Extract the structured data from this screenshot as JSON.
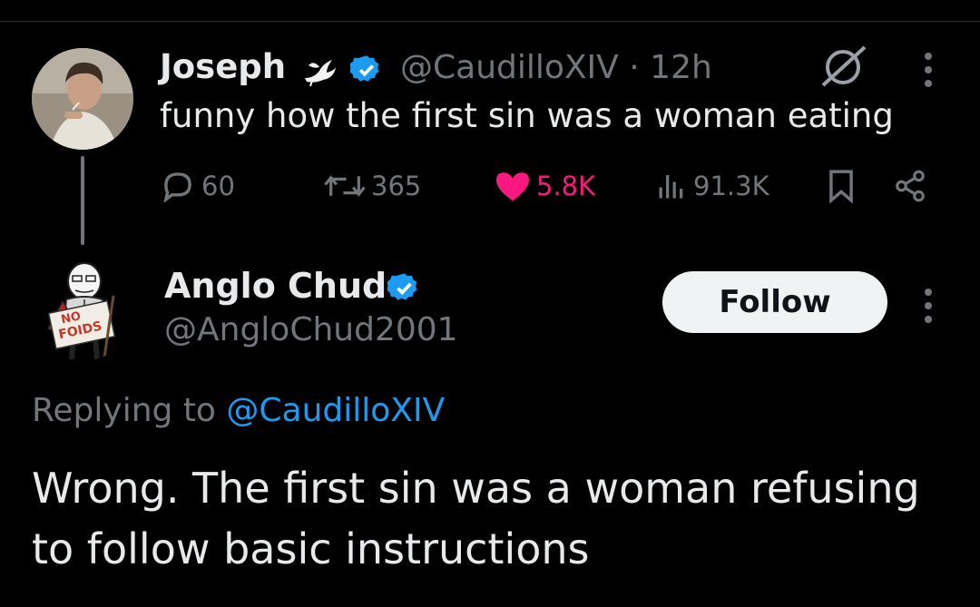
{
  "original_tweet": {
    "author_name": "Joseph",
    "handle": "@CaudilloXIV",
    "separator": "·",
    "time": "12h",
    "text": "funny how the first sin was a woman eating",
    "metrics": {
      "replies": "60",
      "retweets": "365",
      "likes": "5.8K",
      "views": "91.3K"
    },
    "icons": [
      "dove-icon",
      "verified-icon",
      "grok-icon",
      "more-icon",
      "reply-icon",
      "retweet-icon",
      "heart-icon",
      "views-icon",
      "bookmark-icon",
      "share-icon"
    ]
  },
  "reply_tweet": {
    "author_name": "Anglo Chud",
    "handle": "@AngloChud2001",
    "follow_label": "Follow",
    "replying_prefix": "Replying to ",
    "replying_handle": "@CaudilloXIV",
    "text": "Wrong. The first sin was a woman refusing to follow basic instructions",
    "avatar_sign_text": "NO FOIDS"
  },
  "colors": {
    "background": "#000000",
    "text": "#e7e9ea",
    "muted": "#71767b",
    "link": "#1d9bf0",
    "like": "#f91880",
    "verified": "#1d9bf0"
  }
}
